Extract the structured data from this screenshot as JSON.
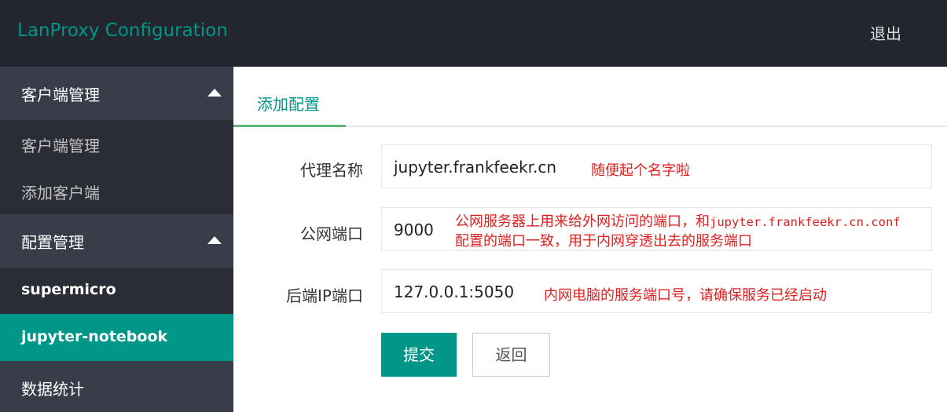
{
  "header": {
    "title": "LanProxy Configuration",
    "logout_label": "退出"
  },
  "sidebar": {
    "groups": [
      {
        "label": "客户端管理",
        "expanded": true,
        "items": [
          {
            "label": "客户端管理"
          },
          {
            "label": "添加客户端"
          }
        ]
      },
      {
        "label": "配置管理",
        "expanded": true,
        "items": [
          {
            "label": "supermicro"
          },
          {
            "label": "jupyter-notebook",
            "active": true
          }
        ]
      }
    ],
    "stats_label": "数据统计"
  },
  "tabs": [
    {
      "label": "添加配置",
      "active": true
    }
  ],
  "form": {
    "proxy_name": {
      "label": "代理名称",
      "value": "jupyter.frankfeekr.cn",
      "note": "随便起个名字啦"
    },
    "public_port": {
      "label": "公网端口",
      "value": "9000",
      "note_line1": "公网服务器上用来给外网访问的端口，和jupyter.frankfeekr.cn.conf",
      "note_line2": "配置的端口一致，用于内网穿透出去的服务端口"
    },
    "backend": {
      "label": "后端IP端口",
      "value": "127.0.0.1:5050",
      "note": "内网电脑的服务端口号，请确保服务已经启动"
    },
    "submit_label": "提交",
    "back_label": "返回"
  },
  "colors": {
    "accent": "#009688",
    "header_bg": "#23262e",
    "sidebar_bg": "#2a2d35",
    "annotation": "#e02020"
  }
}
